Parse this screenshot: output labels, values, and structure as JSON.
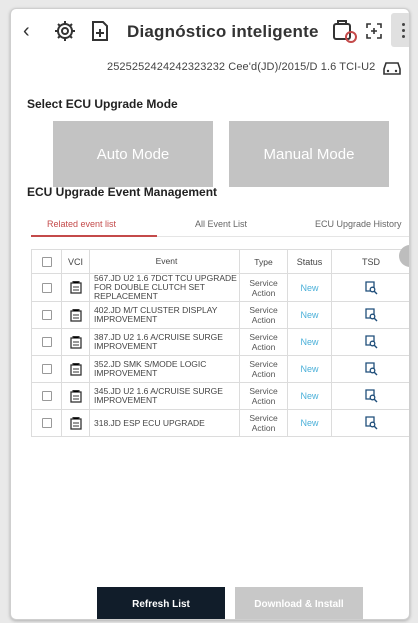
{
  "header": {
    "title": "Diagnóstico inteligente",
    "vin": "2525252424242323232 Cee'd(JD)/2015/D 1.6 TCI-U2"
  },
  "mode": {
    "section_title": "Select ECU Upgrade Mode",
    "auto_label": "Auto Mode",
    "manual_label": "Manual Mode"
  },
  "events": {
    "section_title": "ECU Upgrade Event Management",
    "tabs": [
      {
        "label": "Related event list",
        "active": true
      },
      {
        "label": "All Event List",
        "active": false
      },
      {
        "label": "ECU Upgrade History",
        "active": false
      }
    ],
    "columns": [
      "VCI",
      "Event",
      "Type",
      "Status",
      "TSD"
    ],
    "rows": [
      {
        "event": "567.JD U2 1.6 7DCT TCU UPGRADE FOR DOUBLE CLUTCH SET REPLACEMENT",
        "type": "Service Action",
        "status": "New"
      },
      {
        "event": "402.JD M/T CLUSTER DISPLAY IMPROVEMENT",
        "type": "Service Action",
        "status": "New"
      },
      {
        "event": "387.JD U2 1.6 A/CRUISE SURGE IMPROVEMENT",
        "type": "Service Action",
        "status": "New"
      },
      {
        "event": "352.JD SMK S/MODE LOGIC IMPROVEMENT",
        "type": "Service Action",
        "status": "New"
      },
      {
        "event": "345.JD U2 1.6 A/CRUISE SURGE IMPROVEMENT",
        "type": "Service Action",
        "status": "New"
      },
      {
        "event": "318.JD ESP ECU UPGRADE",
        "type": "Service Action",
        "status": "New"
      }
    ]
  },
  "footer": {
    "refresh_label": "Refresh List",
    "download_label": "Download & Install"
  },
  "colors": {
    "accent_red": "#c44a4a",
    "status_blue": "#4ab0d9",
    "refresh_bg": "#111d2a",
    "disabled_bg": "#c3c3c3"
  },
  "icons": [
    "back-icon",
    "gear-icon",
    "add-file-icon",
    "vehicle-icon",
    "expand-icon",
    "menu-icon",
    "car-icon",
    "vci-icon",
    "tsd-icon"
  ]
}
